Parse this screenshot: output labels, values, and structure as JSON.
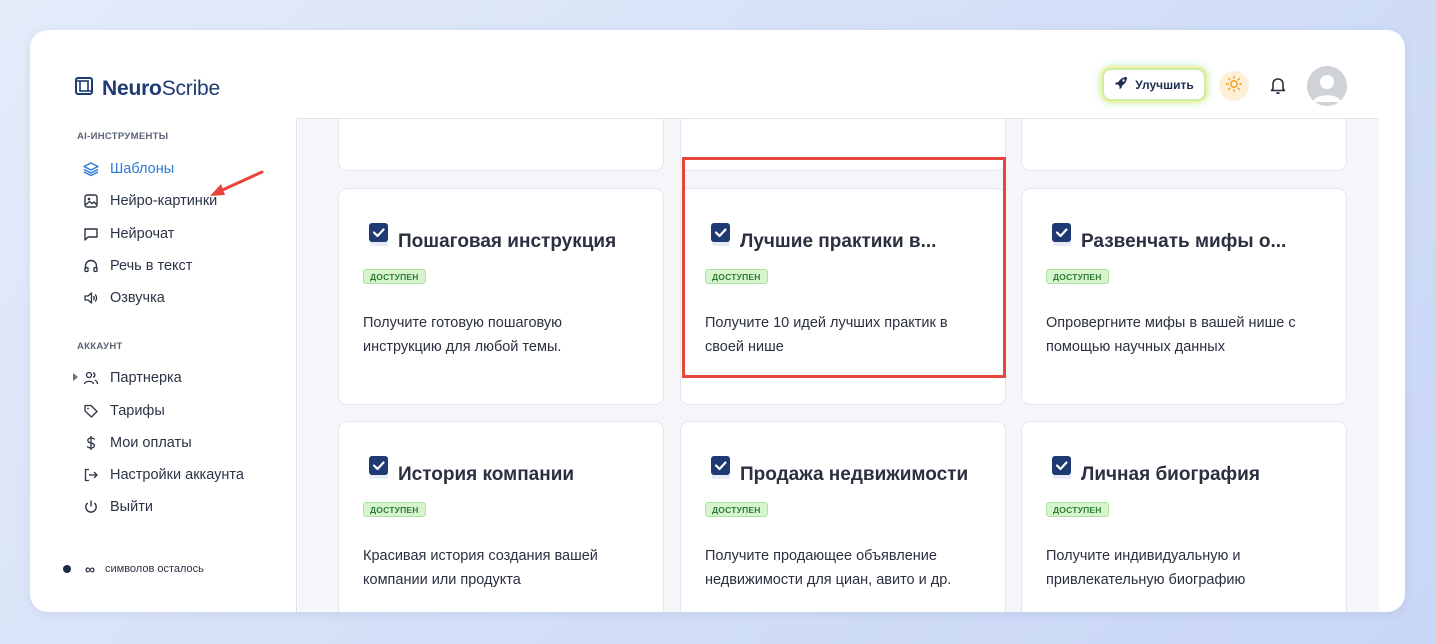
{
  "app": {
    "logo_bold": "Neuro",
    "logo_light": "Scribe",
    "upgrade_label": "Улучшить"
  },
  "sidebar": {
    "section_tools": "AI-ИНСТРУМЕНТЫ",
    "tools": [
      {
        "label": "Шаблоны",
        "icon": "layers-icon",
        "active": true
      },
      {
        "label": "Нейро-картинки",
        "icon": "image-icon"
      },
      {
        "label": "Нейрочат",
        "icon": "chat-icon"
      },
      {
        "label": "Речь в текст",
        "icon": "headphones-icon"
      },
      {
        "label": "Озвучка",
        "icon": "speaker-icon"
      }
    ],
    "section_account": "АККАУНТ",
    "account": [
      {
        "label": "Партнерка",
        "icon": "users-icon"
      },
      {
        "label": "Тарифы",
        "icon": "tag-icon"
      },
      {
        "label": "Мои оплаты",
        "icon": "dollar-icon"
      },
      {
        "label": "Настройки аккаунта",
        "icon": "logout-arrow-icon"
      },
      {
        "label": "Выйти",
        "icon": "power-icon"
      }
    ],
    "symbols_value": "∞",
    "symbols_label": "символов осталось"
  },
  "templates": [
    {
      "title": "Пошаговая инструкция",
      "badge": "ДОСТУПЕН",
      "desc": "Получите готовую пошаговую инструкцию для любой темы."
    },
    {
      "title": "Лучшие практики в...",
      "badge": "ДОСТУПЕН",
      "desc": "Получите 10 идей лучших практик в своей нише"
    },
    {
      "title": "Развенчать мифы о...",
      "badge": "ДОСТУПЕН",
      "desc": "Опровергните мифы в вашей нише с помощью научных данных"
    },
    {
      "title": "История компании",
      "badge": "ДОСТУПЕН",
      "desc": "Красивая история создания вашей компании или продукта"
    },
    {
      "title": "Продажа недвижимости",
      "badge": "ДОСТУПЕН",
      "desc": "Получите продающее объявление недвижимости для циан, авито и др."
    },
    {
      "title": "Личная биография",
      "badge": "ДОСТУПЕН",
      "desc": "Получите индивидуальную и привлекательную биографию"
    }
  ],
  "colors": {
    "accent": "#2a7bd6",
    "brand": "#1d3a73",
    "badge_bg": "#d6f5cf",
    "badge_text": "#2e7d32",
    "annotation": "#e8453c"
  }
}
